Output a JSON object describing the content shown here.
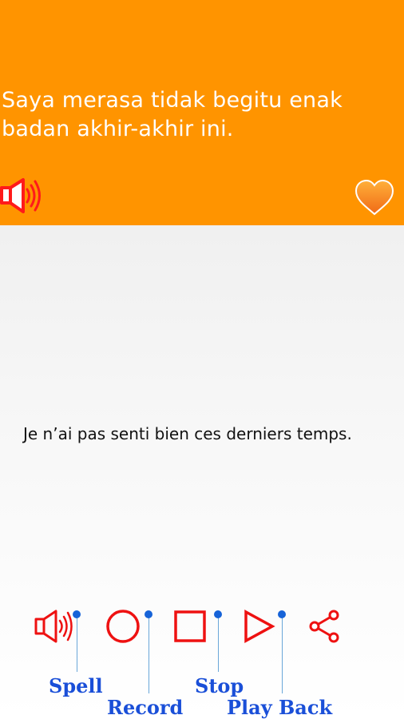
{
  "phrase_panel": {
    "text": "Saya merasa tidak begitu enak badan akhir-akhir ini.",
    "background_color": "#ff9400",
    "speaker_icon": "speaker-icon",
    "favorite_icon": "heart-icon"
  },
  "translation": {
    "text": "Je n’ai pas senti bien ces derniers temps."
  },
  "toolbar": {
    "spell_icon": "speaker-icon",
    "record_icon": "circle-record-icon",
    "stop_icon": "square-stop-icon",
    "play_icon": "triangle-play-icon",
    "share_icon": "share-icon",
    "icon_color": "#ee1111"
  },
  "callouts": {
    "spell": "Spell",
    "record": "Record",
    "stop": "Stop",
    "play_back": "Play Back",
    "label_color": "#1a4fd8"
  }
}
